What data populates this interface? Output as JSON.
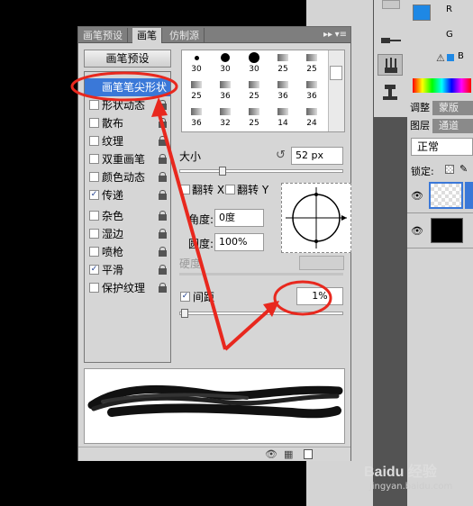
{
  "panel": {
    "tabs": [
      "画笔预设",
      "画笔",
      "仿制源"
    ],
    "preset_button": "画笔预设",
    "list": [
      {
        "label": "画笔笔尖形状",
        "checked": null,
        "selected": true,
        "lock": false
      },
      {
        "label": "形状动态",
        "checked": false,
        "selected": false,
        "lock": true
      },
      {
        "label": "散布",
        "checked": false,
        "selected": false,
        "lock": true
      },
      {
        "label": "纹理",
        "checked": false,
        "selected": false,
        "lock": true
      },
      {
        "label": "双重画笔",
        "checked": false,
        "selected": false,
        "lock": true
      },
      {
        "label": "颜色动态",
        "checked": false,
        "selected": false,
        "lock": true
      },
      {
        "label": "传递",
        "checked": true,
        "selected": false,
        "lock": true
      },
      {
        "label": "杂色",
        "checked": false,
        "selected": false,
        "lock": true
      },
      {
        "label": "湿边",
        "checked": false,
        "selected": false,
        "lock": true
      },
      {
        "label": "喷枪",
        "checked": false,
        "selected": false,
        "lock": true
      },
      {
        "label": "平滑",
        "checked": true,
        "selected": false,
        "lock": true
      },
      {
        "label": "保护纹理",
        "checked": false,
        "selected": false,
        "lock": true
      }
    ],
    "brush_sizes": [
      "30",
      "30",
      "30",
      "25",
      "25",
      "25",
      "36",
      "25",
      "36",
      "36",
      "36",
      "32",
      "25",
      "14",
      "24"
    ],
    "size_label": "大小",
    "size_value": "52 px",
    "flip_x": "翻转 X",
    "flip_y": "翻转 Y",
    "angle_label": "角度:",
    "angle_value": "0度",
    "roundness_label": "圆度:",
    "roundness_value": "100%",
    "hardness_label": "硬度",
    "spacing_label": "间距",
    "spacing_checked": true,
    "spacing_value": "1%",
    "size_slider_fraction": 0.25,
    "spacing_slider_fraction": 0.01
  },
  "color": {
    "foreground": "#1e88e5",
    "background": "#000000",
    "channels": [
      "R",
      "G",
      "B"
    ]
  },
  "layers": {
    "tabs_top": [
      "调整",
      "蒙版"
    ],
    "tabs": [
      "图层",
      "通道"
    ],
    "blend_mode": "正常",
    "lock_label": "锁定:"
  },
  "watermark": "Baidu 经验",
  "watermark_url": "jingyan.baidu.com",
  "annotation_color": "#e8281e"
}
